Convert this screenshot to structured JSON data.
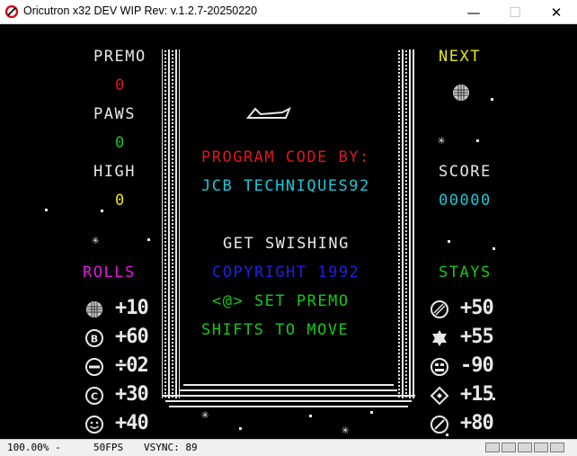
{
  "window": {
    "title": "Oricutron x32 DEV WIP Rev: v.1.2.7-20250220",
    "minimize_glyph": "—",
    "maximize_glyph": "☐",
    "close_glyph": "✕",
    "icon": "oricutron-app-icon"
  },
  "left_panel": {
    "premo_label": "PREMO",
    "premo_value": "0",
    "paws_label": "PAWS",
    "paws_value": "0",
    "high_label": "HIGH",
    "high_value": "0",
    "rolls_label": "ROLLS",
    "rolls": [
      {
        "icon": "disco-ball-icon",
        "value": "+10"
      },
      {
        "icon": "letter-b-ball-icon",
        "value": "+60"
      },
      {
        "icon": "minus-ball-icon",
        "value": "÷02"
      },
      {
        "icon": "letter-c-ball-icon",
        "value": "+30"
      },
      {
        "icon": "smiley-ball-icon",
        "value": "+40"
      }
    ]
  },
  "right_panel": {
    "next_label": "NEXT",
    "next_icon": "disco-ball-icon",
    "score_label": "SCORE",
    "score_value": "00000",
    "stays_label": "STAYS",
    "stays": [
      {
        "icon": "striped-ball-icon",
        "value": "+50"
      },
      {
        "icon": "star-of-david-icon",
        "value": "+55"
      },
      {
        "icon": "face-ball-icon",
        "value": "-90"
      },
      {
        "icon": "diamond-icon",
        "value": "+15"
      },
      {
        "icon": "slash-ball-icon",
        "value": "+80"
      }
    ]
  },
  "center": {
    "line1": "PROGRAM CODE BY:",
    "line2": "JCB TECHNIQUES92",
    "line3": "GET SWISHING",
    "line4": "COPYRIGHT 1992",
    "line5": "<@>  SET PREMO",
    "line6": "SHIFTS TO MOVE",
    "paddle_icon": "paddle-icon"
  },
  "colors": {
    "red": "#e01818",
    "green": "#18c818",
    "yellow": "#e8e818",
    "cyan": "#18c8d8",
    "magenta": "#e018e0",
    "blue": "#2020e0",
    "white": "#e8e8e8"
  },
  "status": {
    "zoom": "100.00% -",
    "fps": "50FPS",
    "vsync": "VSYNC: 89"
  }
}
